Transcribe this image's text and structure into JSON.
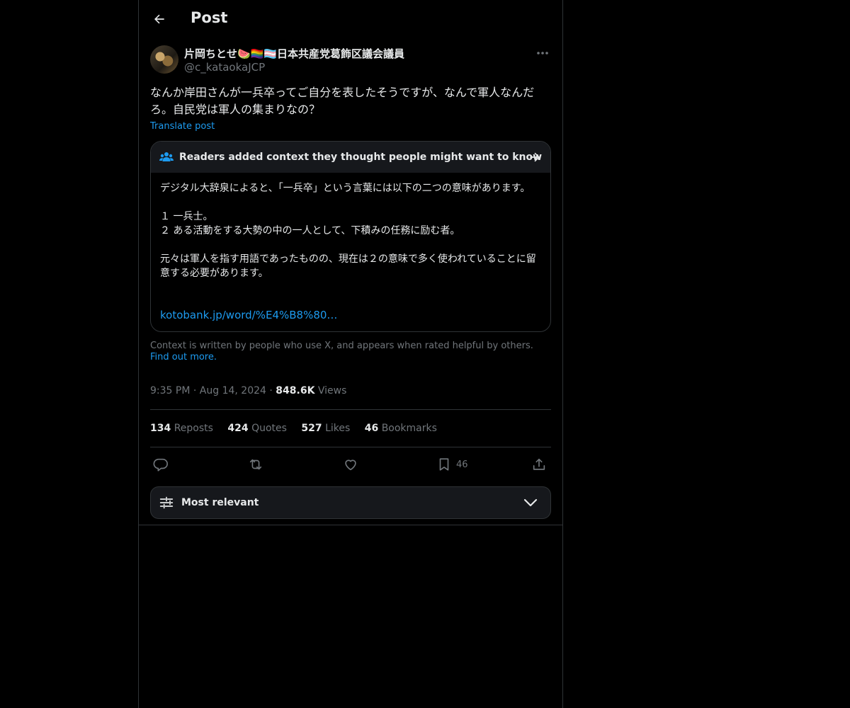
{
  "header": {
    "title": "Post"
  },
  "author": {
    "name": "片岡ちとせ🍉🏳️‍🌈🏳️‍⚧️日本共産党葛飾区議会議員",
    "handle": "@c_kataokaJCP"
  },
  "post": {
    "text": "なんか岸田さんが一兵卒ってご自分を表したそうですが、なんで軍人なんだろ。自民党は軍人の集まりなの？",
    "translate_label": "Translate post"
  },
  "community_note": {
    "title": "Readers added context they thought people might want to know",
    "body": "デジタル大辞泉によると、「一兵卒」という言葉には以下の二つの意味があります。\n\n１ 一兵士。\n２ ある活動をする大勢の中の一人として、下積みの任務に励む者。\n\n元々は軍人を指す用語であったものの、現在は２の意味で多く使われていることに留意する必要があります。",
    "link": "kotobank.jp/word/%E4%B8%80…",
    "footer": "Context is written by people who use X, and appears when rated helpful by others.",
    "footer_link": "Find out more."
  },
  "meta": {
    "time": "9:35 PM",
    "date": "Aug 14, 2024",
    "views_count": "848.6K",
    "views_label": "Views"
  },
  "stats": {
    "reposts_count": "134",
    "reposts_label": "Reposts",
    "quotes_count": "424",
    "quotes_label": "Quotes",
    "likes_count": "527",
    "likes_label": "Likes",
    "bookmarks_count": "46",
    "bookmarks_label": "Bookmarks"
  },
  "actions": {
    "bookmark_count": "46"
  },
  "sort": {
    "label": "Most relevant"
  },
  "colors": {
    "accent": "#1d9bf0",
    "muted": "#71767b",
    "border": "#2f3336"
  },
  "icons": [
    "back-arrow-icon",
    "more-icon",
    "people-icon",
    "arrow-right-icon",
    "reply-icon",
    "repost-icon",
    "like-icon",
    "bookmark-icon",
    "share-icon",
    "sliders-icon",
    "chevron-down-icon"
  ]
}
